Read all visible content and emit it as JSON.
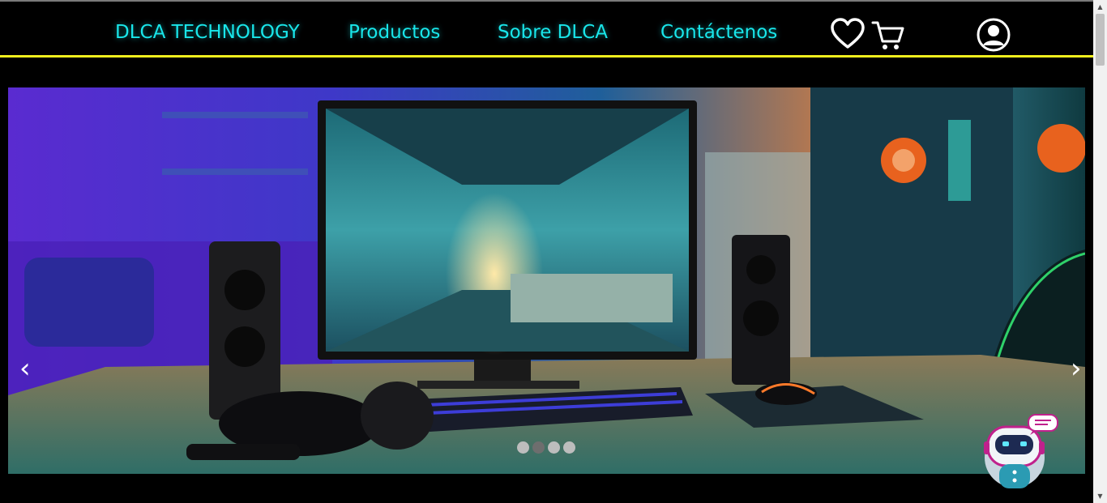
{
  "nav": {
    "brand": "DLCA TECHNOLOGY",
    "links": [
      "Productos",
      "Sobre DLCA",
      "Contáctenos"
    ],
    "icons": [
      "heart-icon",
      "cart-icon",
      "user-icon"
    ]
  },
  "carousel": {
    "prev_arrow": "‹",
    "next_arrow": "›",
    "slide_count": 4,
    "active_slide_index": 1
  },
  "colors": {
    "nav_text": "#19e6ea",
    "nav_underline": "#f2ef1d",
    "background": "#000000"
  },
  "chatbot": {
    "icon": "robot-chat-icon"
  }
}
